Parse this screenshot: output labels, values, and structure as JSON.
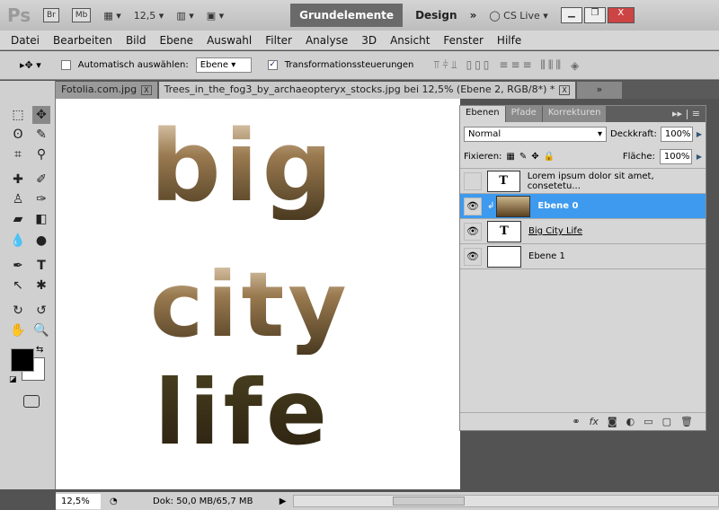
{
  "appbar": {
    "logo": "Ps",
    "br": "Br",
    "mb": "Mb",
    "zoom": "12,5",
    "workspace_active": "Grundelemente",
    "workspace_design": "Design",
    "more": "»",
    "cslive": "CS Live"
  },
  "menu": [
    "Datei",
    "Bearbeiten",
    "Bild",
    "Ebene",
    "Auswahl",
    "Filter",
    "Analyse",
    "3D",
    "Ansicht",
    "Fenster",
    "Hilfe"
  ],
  "options": {
    "auto_select_label": "Automatisch auswählen:",
    "auto_select_value": "Ebene",
    "transform_label": "Transformationssteuerungen"
  },
  "tabs": [
    {
      "label": "Fotolia.com.jpg"
    },
    {
      "label": "Trees_in_the_fog3_by_archaeopteryx_stocks.jpg bei 12,5% (Ebene 2, RGB/8*) *"
    }
  ],
  "canvas": {
    "line1": "big",
    "line2": "city",
    "line3": "life"
  },
  "layers_panel": {
    "tabs": [
      "Ebenen",
      "Pfade",
      "Korrekturen"
    ],
    "blend_mode": "Normal",
    "opacity_label": "Deckkraft:",
    "opacity": "100%",
    "lock_label": "Fixieren:",
    "fill_label": "Fläche:",
    "fill": "100%",
    "layers": [
      {
        "name": "Lorem ipsum dolor sit amet, consetetu...",
        "thumb": "T",
        "visible": false
      },
      {
        "name": "Ebene 0",
        "thumb": "",
        "visible": true,
        "selected": true
      },
      {
        "name": "Big City Life",
        "thumb": "T",
        "visible": true
      },
      {
        "name": "Ebene 1",
        "thumb": "",
        "visible": true
      }
    ]
  },
  "status": {
    "zoom": "12,5%",
    "doc": "Dok: 50,0 MB/65,7 MB"
  }
}
